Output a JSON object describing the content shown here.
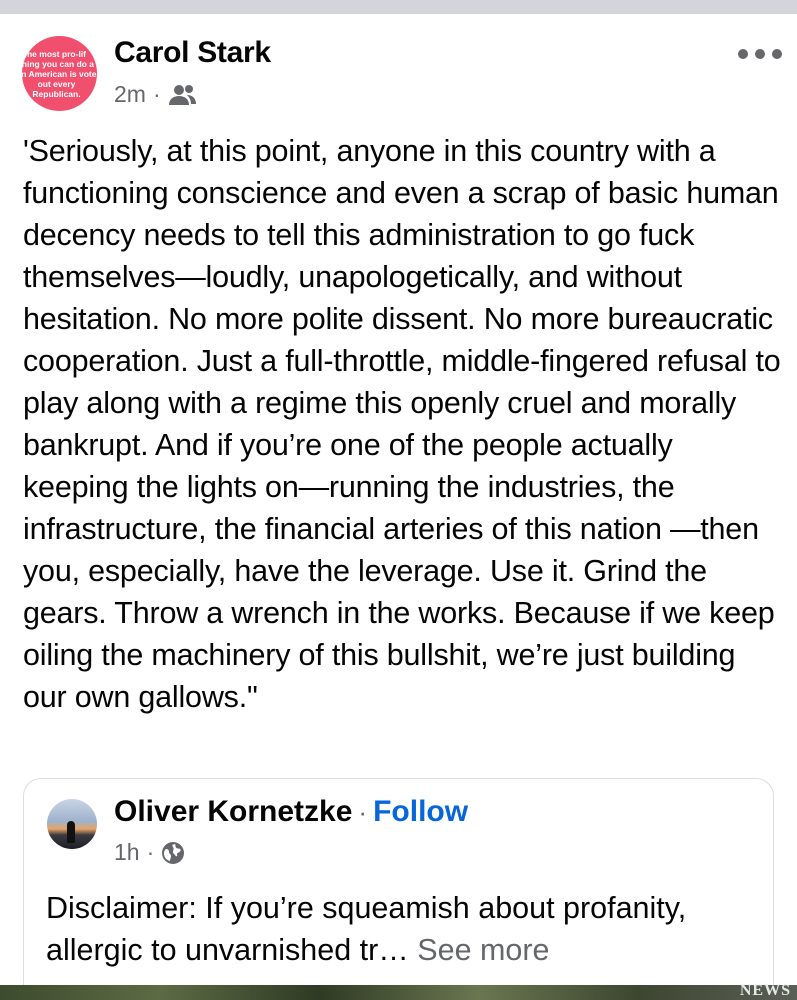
{
  "post": {
    "author": "Carol Stark",
    "avatar_text": "he most pro-lif\nthing you can do a\nan American is vote\nout every\nRepublican.",
    "timestamp": "2m",
    "separator": "·",
    "audience_icon": "friends-icon",
    "more_icon": "more-options-icon",
    "body": "'Seriously, at this point, anyone in this country with a functioning conscience and even a scrap of basic human decency needs to tell this administration to go fuck themselves—loudly, unapologetically, and without hesitation. No more polite dissent. No more bureaucratic cooperation. Just a full-throttle, middle-fingered refusal to play along with a regime this openly cruel and morally bankrupt. And if you’re one of the people actually keeping the lights on—running the industries, the infrastructure, the financial arteries of this nation —then you, especially, have the leverage. Use it. Grind the gears. Throw a wrench in the works. Because if we keep oiling the machinery of this bullshit, we’re just building our own gallows.\""
  },
  "shared_post": {
    "author": "Oliver Kornetzke",
    "separator": "·",
    "follow_label": "Follow",
    "timestamp": "1h",
    "audience_icon": "globe-icon",
    "body_preview": "Disclaimer: If you’re squeamish about profanity, allergic to unvarnished tr…",
    "see_more_label": "See more"
  },
  "media_preview": {
    "badge": "NEWS"
  },
  "colors": {
    "link_blue": "#0866d9",
    "secondary_text": "#65676b",
    "avatar_pink": "#f0506e",
    "divider": "#d3d5da"
  }
}
